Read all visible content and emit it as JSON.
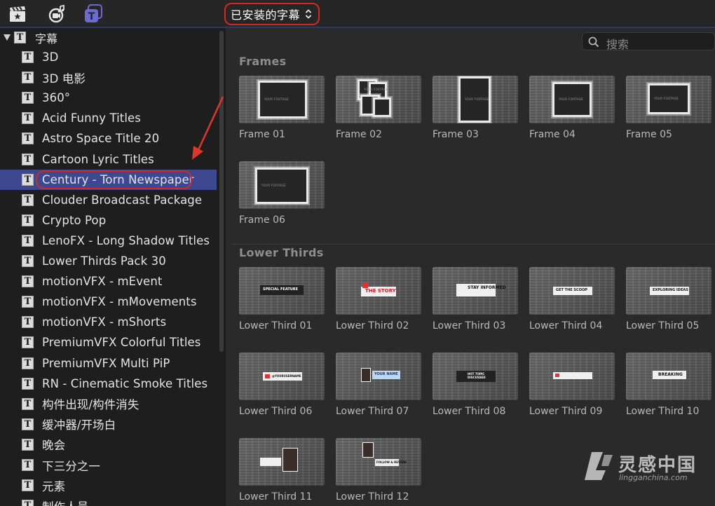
{
  "toolbar": {
    "library_selector": "已安装的字幕",
    "icons": [
      "clapper-star-icon",
      "music-camera-icon",
      "titles-icon"
    ],
    "accent_color": "#6b6bd6"
  },
  "sidebar": {
    "root_label": "字幕",
    "selected_index": 6,
    "items": [
      {
        "label": "3D"
      },
      {
        "label": "3D 电影"
      },
      {
        "label": "360°"
      },
      {
        "label": "Acid Funny Titles"
      },
      {
        "label": "Astro Space Title 20"
      },
      {
        "label": "Cartoon Lyric Titles"
      },
      {
        "label": "Century - Torn Newspaper"
      },
      {
        "label": "Clouder Broadcast Package"
      },
      {
        "label": "Crypto Pop"
      },
      {
        "label": "LenoFX - Long Shadow Titles"
      },
      {
        "label": "Lower Thirds Pack 30"
      },
      {
        "label": "motionVFX - mEvent"
      },
      {
        "label": "motionVFX - mMovements"
      },
      {
        "label": "motionVFX - mShorts"
      },
      {
        "label": "PremiumVFX Colorful Titles"
      },
      {
        "label": "PremiumVFX Multi PiP"
      },
      {
        "label": "RN - Cinematic Smoke Titles"
      },
      {
        "label": "构件出现/构件消失"
      },
      {
        "label": "缓冲器/开场白"
      },
      {
        "label": "晚会"
      },
      {
        "label": "下三分之一"
      },
      {
        "label": "元素"
      },
      {
        "label": "制作人员"
      }
    ]
  },
  "browser": {
    "search_placeholder": "搜索",
    "sections": [
      {
        "title": "Frames",
        "clips": [
          {
            "label": "Frame 01",
            "thumb_text": "YOUR FOOTAGE"
          },
          {
            "label": "Frame 02",
            "thumb_text": "YOUR FOOTAGE"
          },
          {
            "label": "Frame 03",
            "thumb_text": "YOUR FOOTAGE"
          },
          {
            "label": "Frame 04",
            "thumb_text": "YOUR FOOTAGE"
          },
          {
            "label": "Frame 05",
            "thumb_text": "YOUR FOOTAGE"
          },
          {
            "label": "Frame 06",
            "thumb_text": "YOUR FOOTAGE"
          }
        ]
      },
      {
        "title": "Lower Thirds",
        "clips": [
          {
            "label": "Lower Third 01",
            "thumb_text": "SPECIAL FEATURE"
          },
          {
            "label": "Lower Third 02",
            "thumb_text": "THE STORY"
          },
          {
            "label": "Lower Third 03",
            "thumb_text": "STAY INFORMED"
          },
          {
            "label": "Lower Third 04",
            "thumb_text": "GET THE SCOOP"
          },
          {
            "label": "Lower Third 05",
            "thumb_text": "EXPLORING IDEAS"
          },
          {
            "label": "Lower Third 06",
            "thumb_text": "@YOURUSERNAME"
          },
          {
            "label": "Lower Third 07",
            "thumb_text": "YOUR NAME"
          },
          {
            "label": "Lower Third 08",
            "thumb_text": "HOT TOPIC DISCUSSED"
          },
          {
            "label": "Lower Third 09",
            "thumb_text": ""
          },
          {
            "label": "Lower Third 10",
            "thumb_text": "BREAKING"
          },
          {
            "label": "Lower Third 11",
            "thumb_text": ""
          },
          {
            "label": "Lower Third 12",
            "thumb_text": "FOLLOW & REVIEW"
          }
        ]
      }
    ]
  },
  "watermark": {
    "text": "灵感中国",
    "url": "lingganchina.com"
  },
  "annotation": {
    "highlight_color": "#d6281f"
  }
}
